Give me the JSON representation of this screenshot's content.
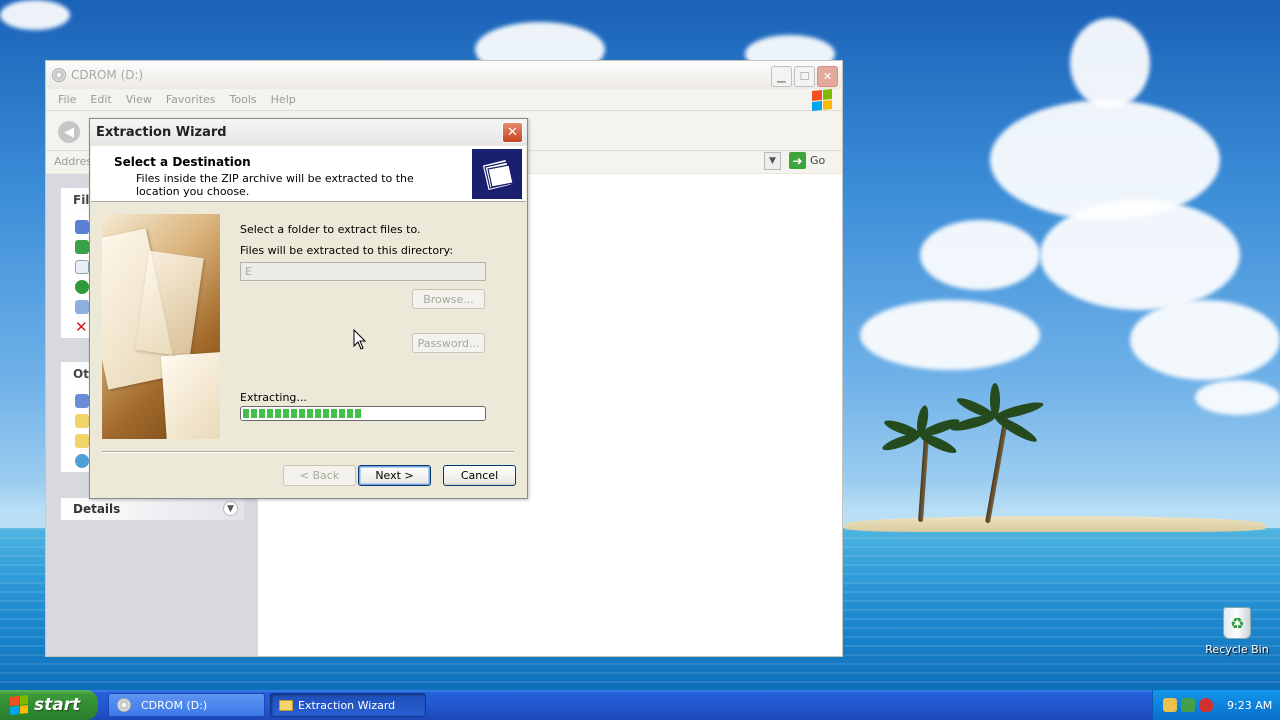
{
  "explorer": {
    "title": "CDROM (D:)",
    "menu": [
      "File",
      "Edit",
      "View",
      "Favorites",
      "Tools",
      "Help"
    ],
    "address_label": "Address",
    "go_label": "Go",
    "taskpane": {
      "file_tasks_head": "Fil",
      "other_places_head": "Ot",
      "details_head": "Details"
    }
  },
  "wizard": {
    "title": "Extraction Wizard",
    "header_title": "Select a Destination",
    "header_subtitle": "Files inside the ZIP archive will be extracted to the location you choose.",
    "select_folder_label": "Select a folder to extract files to.",
    "directory_label": "Files will be extracted to this directory:",
    "directory_value": "E",
    "browse_label": "Browse...",
    "password_label": "Password...",
    "extracting_label": "Extracting...",
    "progress_fraction": 0.5,
    "back_label": "< Back",
    "next_label": "Next >",
    "cancel_label": "Cancel"
  },
  "desktop": {
    "recycle_bin_label": "Recycle Bin"
  },
  "taskbar": {
    "start_label": "start",
    "tasks": [
      {
        "label": "CDROM (D:)",
        "active": false
      },
      {
        "label": "Extraction Wizard",
        "active": true
      }
    ],
    "clock": "9:23 AM"
  },
  "icons": {
    "cd": "cd-drive-icon",
    "back": "back-arrow-icon",
    "go": "go-arrow-icon",
    "wizard_header": "folder-files-icon",
    "close": "close-icon",
    "recycle": "recycle-bin-icon",
    "windows_flag": "windows-flag-icon"
  }
}
